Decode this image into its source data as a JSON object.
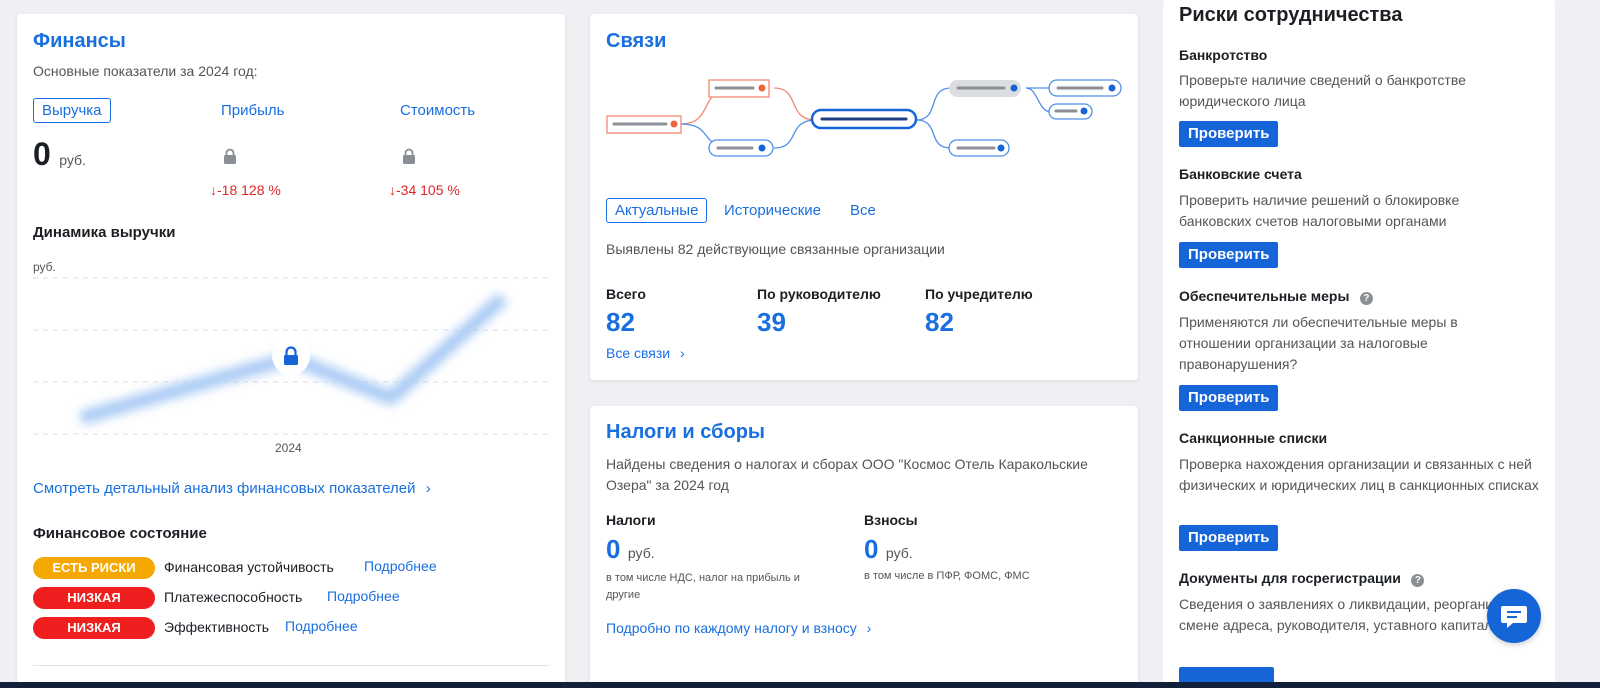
{
  "finance": {
    "title": "Финансы",
    "subtitle": "Основные показатели за 2024 год:",
    "tabs": [
      "Выручка",
      "Прибыль",
      "Стоимость"
    ],
    "revenue_value": "0",
    "revenue_unit": "руб.",
    "profit_change": "↓-18 128 %",
    "cost_change": "↓-34 105 %",
    "dynamics_title": "Динамика выручки",
    "axis_unit": "руб.",
    "x_label": "2024",
    "detail_link": "Смотреть детальный анализ финансовых показателей",
    "state_title": "Финансовое состояние",
    "states": [
      {
        "badge": "ЕСТЬ РИСКИ",
        "badge_color": "#f5a800",
        "label": "Финансовая устойчивость",
        "link": "Подробнее"
      },
      {
        "badge": "НИЗКАЯ",
        "badge_color": "#ef1f1f",
        "label": "Платежеспособность",
        "link": "Подробнее"
      },
      {
        "badge": "НИЗКАЯ",
        "badge_color": "#ef1f1f",
        "label": "Эффективность",
        "link": "Подробнее"
      }
    ]
  },
  "links": {
    "title": "Связи",
    "tabs": [
      "Актуальные",
      "Исторические",
      "Все"
    ],
    "found_text": "Выявлены 82 действующие связанные организации",
    "stats": [
      {
        "label": "Всего",
        "value": "82"
      },
      {
        "label": "По руководителю",
        "value": "39"
      },
      {
        "label": "По учредителю",
        "value": "82"
      }
    ],
    "all_link": "Все связи"
  },
  "taxes": {
    "title": "Налоги и сборы",
    "description": "Найдены сведения о налогах и сборах ООО \"Космос Отель Каракольские Озера\" за 2024 год",
    "taxes_label": "Налоги",
    "taxes_value": "0",
    "taxes_unit": "руб.",
    "taxes_note": "в том числе НДС, налог на прибыль и другие",
    "contrib_label": "Взносы",
    "contrib_value": "0",
    "contrib_unit": "руб.",
    "contrib_note": "в том числе в ПФР, ФОМС, ФМС",
    "detail_link": "Подробно по каждому налогу и взносу"
  },
  "risks": {
    "title": "Риски сотрудничества",
    "check_label": "Проверить",
    "items": [
      {
        "title": "Банкротство",
        "desc": "Проверьте наличие сведений о банкротстве юридического лица"
      },
      {
        "title": "Банковские счета",
        "desc": "Проверить наличие решений о блокировке банковских счетов налоговыми органами"
      },
      {
        "title": "Обеспечительные меры",
        "desc": "Применяются ли обеспечительные меры в отношении организации за налоговые правонарушения?"
      },
      {
        "title": "Санкционные списки",
        "desc": "Проверка нахождения организации и связанных с ней физических и юридических лиц в санкционных списках"
      },
      {
        "title": "Документы для госрегистрации",
        "desc": "Сведения о заявлениях о ликвидации, реорганизации, смене адреса, руководителя, уставного капитала"
      }
    ]
  },
  "colors": {
    "accent": "#1a6fe0",
    "button": "#1565d8",
    "risk": "#f5a800",
    "low": "#ef1f1f"
  }
}
